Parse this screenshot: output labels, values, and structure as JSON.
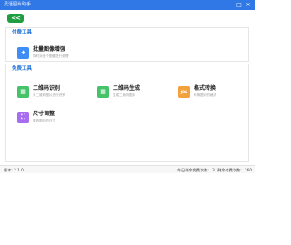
{
  "window": {
    "title": "灵活图片助手",
    "controls": [
      "–",
      "□",
      "✕"
    ]
  },
  "toolbar": {
    "back_label": "<<"
  },
  "paid_tools": {
    "title": "付费工具",
    "items": [
      {
        "icon": "image-enhance-icon",
        "glyph": "✦",
        "name": "批量图像增强",
        "desc": "同时对多个图像进行处理"
      }
    ]
  },
  "free_tools": {
    "title": "免费工具",
    "items": [
      {
        "icon": "qr-scan-icon",
        "glyph": "▦",
        "name": "二维码识别",
        "desc": "对二维码图片进行识别"
      },
      {
        "icon": "qr-generate-icon",
        "glyph": "▦",
        "name": "二维码生成",
        "desc": "生成二维码图片"
      },
      {
        "icon": "format-convert-icon",
        "glyph": "JPG PNG",
        "name": "格式转换",
        "desc": "转换图片的格式"
      },
      {
        "icon": "resize-icon",
        "glyph": "⛶",
        "name": "尺寸调整",
        "desc": "更改图片的尺寸"
      }
    ]
  },
  "status": {
    "version": "版本: 2.1.0",
    "today_count_label": "今日剩余免费次数:",
    "today_count": "3",
    "total_count_label": "剩余付费次数:",
    "total_count": "260"
  },
  "colors": {
    "titlebar": "#2f78e6",
    "back_button": "#1e9e40",
    "section_title": "#1a6fd8"
  }
}
